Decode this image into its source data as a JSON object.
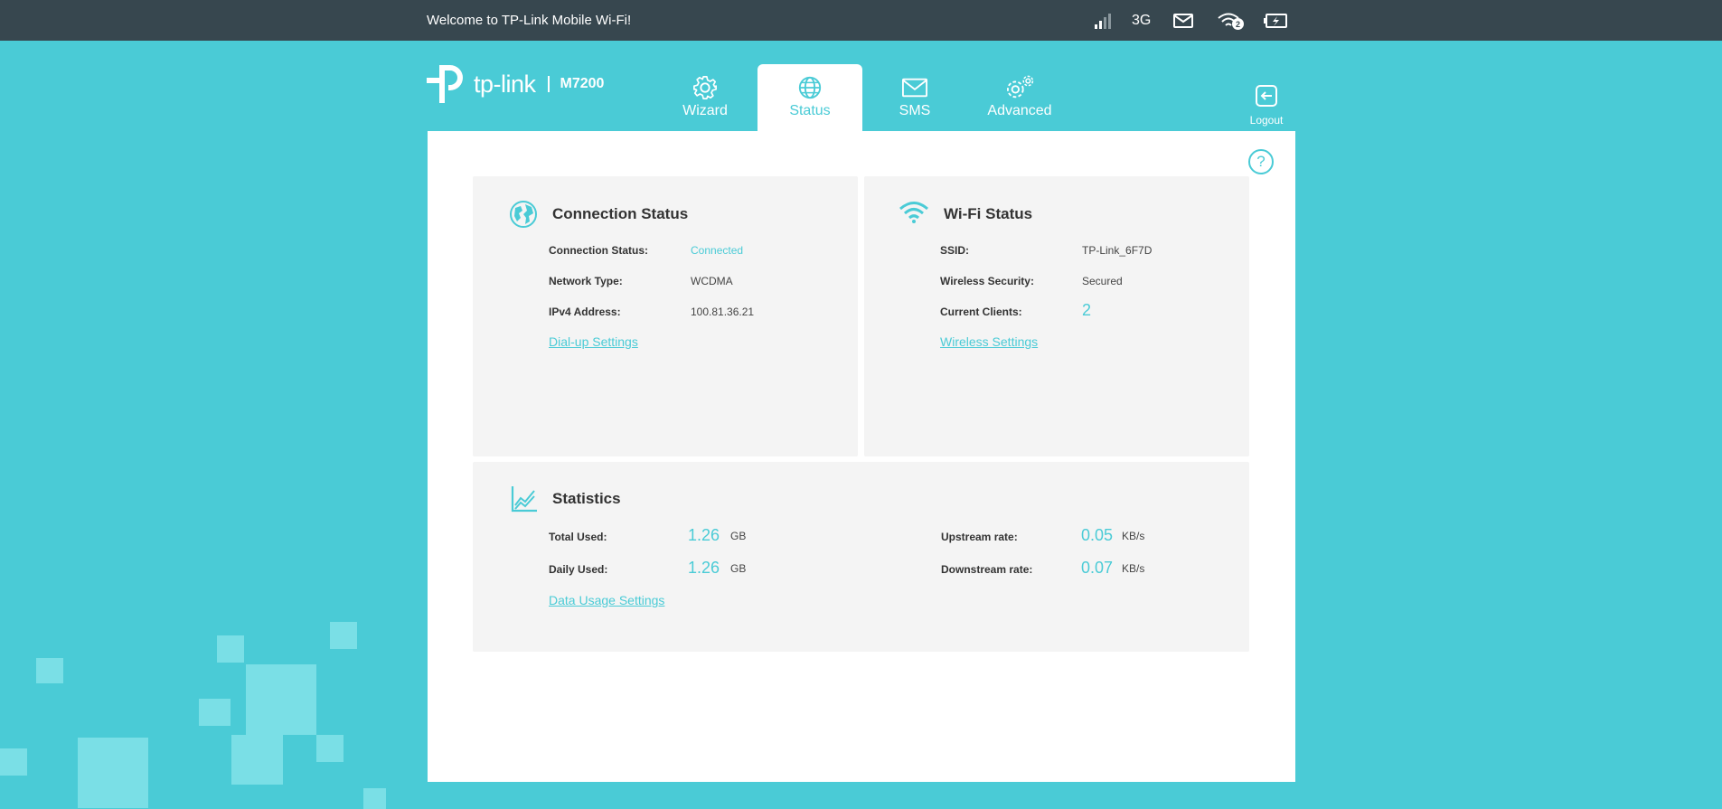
{
  "topbar": {
    "welcome": "Welcome to TP-Link Mobile Wi-Fi!",
    "network_type": "3G",
    "wifi_clients_badge": "2",
    "icons": [
      "signal-icon",
      "mail-icon",
      "wifi-icon",
      "battery-icon"
    ]
  },
  "header": {
    "brand": "tp-link",
    "model": "M7200",
    "tabs": [
      {
        "label": "Wizard",
        "icon": "gear-icon",
        "active": false
      },
      {
        "label": "Status",
        "icon": "globe-icon",
        "active": true
      },
      {
        "label": "SMS",
        "icon": "envelope-icon",
        "active": false
      },
      {
        "label": "Advanced",
        "icon": "gears-icon",
        "active": false
      }
    ],
    "logout_label": "Logout"
  },
  "connection": {
    "title": "Connection Status",
    "rows": [
      {
        "label": "Connection Status:",
        "value": "Connected"
      },
      {
        "label": "Network Type:",
        "value": "WCDMA"
      },
      {
        "label": "IPv4 Address:",
        "value": "100.81.36.21"
      }
    ],
    "link": "Dial-up Settings"
  },
  "wifi": {
    "title": "Wi-Fi Status",
    "rows": [
      {
        "label": "SSID:",
        "value": "TP-Link_6F7D"
      },
      {
        "label": "Wireless Security:",
        "value": "Secured"
      },
      {
        "label": "Current Clients:",
        "value": "2"
      }
    ],
    "link": "Wireless Settings"
  },
  "statistics": {
    "title": "Statistics",
    "total_used": {
      "label": "Total Used:",
      "value": "1.26",
      "unit": "GB"
    },
    "daily_used": {
      "label": "Daily Used:",
      "value": "1.26",
      "unit": "GB"
    },
    "upstream": {
      "label": "Upstream rate:",
      "value": "0.05",
      "unit": "KB/s"
    },
    "downstream": {
      "label": "Downstream rate:",
      "value": "0.07",
      "unit": "KB/s"
    },
    "link": "Data Usage Settings"
  },
  "colors": {
    "accent": "#4acbd6",
    "topbar": "#37474f",
    "card": "#f4f4f4"
  }
}
